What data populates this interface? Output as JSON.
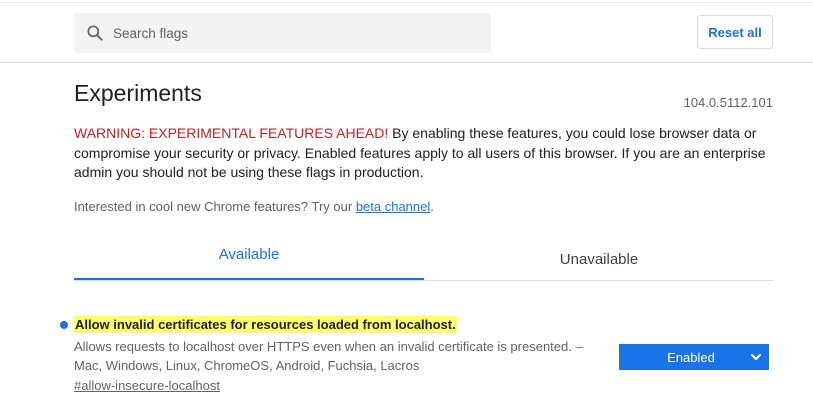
{
  "header": {
    "search": {
      "placeholder": "Search flags",
      "value": ""
    },
    "reset_label": "Reset all"
  },
  "main": {
    "title": "Experiments",
    "version": "104.0.5112.101",
    "warning_label": "WARNING: EXPERIMENTAL FEATURES AHEAD!",
    "warning_text": " By enabling these features, you could lose browser data or compromise your security or privacy. Enabled features apply to all users of this browser. If you are an enterprise admin you should not be using these flags in production.",
    "interest_prefix": "Interested in cool new Chrome features? Try our ",
    "interest_link": "beta channel",
    "interest_suffix": "."
  },
  "tabs": [
    {
      "label": "Available",
      "selected": true
    },
    {
      "label": "Unavailable",
      "selected": false
    }
  ],
  "experiments": [
    {
      "name": "Allow invalid certificates for resources loaded from localhost.",
      "description": "Allows requests to localhost over HTTPS even when an invalid certificate is presented. – Mac, Windows, Linux, ChromeOS, Android, Fuchsia, Lacros",
      "id": "#allow-insecure-localhost",
      "state": "Enabled"
    }
  ],
  "icons": {
    "search": "search-icon",
    "chevron": "chevron-down-icon",
    "modified_indicator": "dot-icon"
  },
  "colors": {
    "accent": "#1a73e8",
    "warning": "#c5221f",
    "highlight": "#ffff6e"
  }
}
